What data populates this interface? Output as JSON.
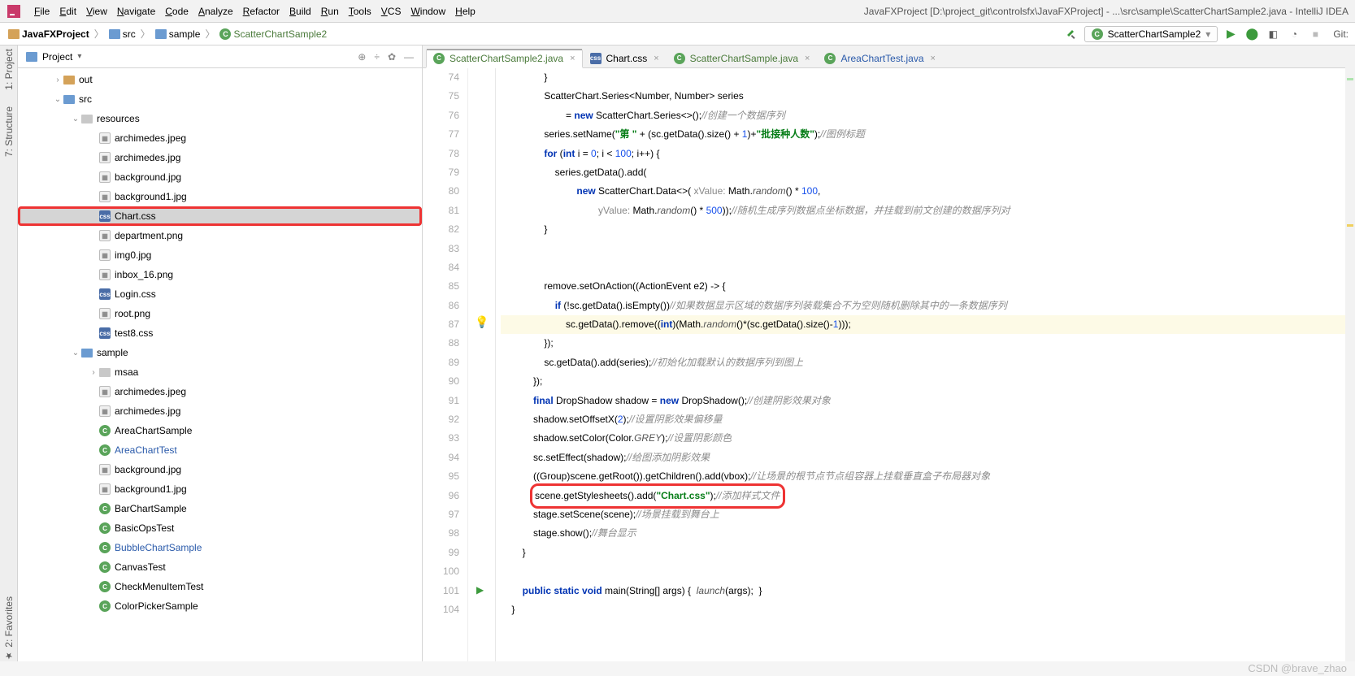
{
  "window": {
    "title": "JavaFXProject [D:\\project_git\\controlsfx\\JavaFXProject] - ...\\src\\sample\\ScatterChartSample2.java - IntelliJ IDEA"
  },
  "menu": [
    "File",
    "Edit",
    "View",
    "Navigate",
    "Code",
    "Analyze",
    "Refactor",
    "Build",
    "Run",
    "Tools",
    "VCS",
    "Window",
    "Help"
  ],
  "breadcrumb": {
    "items": [
      {
        "icon": "folder-orange",
        "text": "JavaFXProject",
        "bold": true
      },
      {
        "icon": "folder-blue",
        "text": "src"
      },
      {
        "icon": "folder-blue",
        "text": "sample"
      },
      {
        "icon": "class",
        "text": "ScatterChartSample2",
        "green": true
      }
    ]
  },
  "runConfig": "ScatterChartSample2",
  "gitLabel": "Git:",
  "projectPanel": {
    "title": "Project"
  },
  "tree": [
    {
      "indent": 1,
      "toggle": ">",
      "icon": "folder-orange",
      "label": "out"
    },
    {
      "indent": 1,
      "toggle": "v",
      "icon": "folder-blue",
      "label": "src"
    },
    {
      "indent": 2,
      "toggle": "v",
      "icon": "folder-gray",
      "label": "resources"
    },
    {
      "indent": 3,
      "icon": "img",
      "label": "archimedes.jpeg"
    },
    {
      "indent": 3,
      "icon": "img",
      "label": "archimedes.jpg"
    },
    {
      "indent": 3,
      "icon": "img",
      "label": "background.jpg"
    },
    {
      "indent": 3,
      "icon": "img",
      "label": "background1.jpg"
    },
    {
      "indent": 3,
      "icon": "css",
      "label": "Chart.css",
      "selected": true,
      "highlighted": true
    },
    {
      "indent": 3,
      "icon": "img",
      "label": "department.png"
    },
    {
      "indent": 3,
      "icon": "img",
      "label": "img0.jpg"
    },
    {
      "indent": 3,
      "icon": "img",
      "label": "inbox_16.png"
    },
    {
      "indent": 3,
      "icon": "css",
      "label": "Login.css"
    },
    {
      "indent": 3,
      "icon": "img",
      "label": "root.png"
    },
    {
      "indent": 3,
      "icon": "css",
      "label": "test8.css"
    },
    {
      "indent": 2,
      "toggle": "v",
      "icon": "folder-blue",
      "label": "sample"
    },
    {
      "indent": 3,
      "toggle": ">",
      "icon": "folder-gray",
      "label": "msaa"
    },
    {
      "indent": 3,
      "icon": "img",
      "label": "archimedes.jpeg"
    },
    {
      "indent": 3,
      "icon": "img",
      "label": "archimedes.jpg"
    },
    {
      "indent": 3,
      "icon": "cls",
      "label": "AreaChartSample"
    },
    {
      "indent": 3,
      "icon": "cls",
      "label": "AreaChartTest",
      "blue": true
    },
    {
      "indent": 3,
      "icon": "img",
      "label": "background.jpg"
    },
    {
      "indent": 3,
      "icon": "img",
      "label": "background1.jpg"
    },
    {
      "indent": 3,
      "icon": "cls",
      "label": "BarChartSample"
    },
    {
      "indent": 3,
      "icon": "cls",
      "label": "BasicOpsTest"
    },
    {
      "indent": 3,
      "icon": "cls",
      "label": "BubbleChartSample",
      "blue": true
    },
    {
      "indent": 3,
      "icon": "cls",
      "label": "CanvasTest"
    },
    {
      "indent": 3,
      "icon": "cls",
      "label": "CheckMenuItemTest"
    },
    {
      "indent": 3,
      "icon": "cls",
      "label": "ColorPickerSample"
    }
  ],
  "tabs": [
    {
      "icon": "cls",
      "label": "ScatterChartSample2.java",
      "active": true,
      "green": true
    },
    {
      "icon": "css",
      "label": "Chart.css"
    },
    {
      "icon": "cls",
      "label": "ScatterChartSample.java",
      "green": true
    },
    {
      "icon": "cls",
      "label": "AreaChartTest.java",
      "blue": true
    }
  ],
  "code": {
    "startLine": 74,
    "lines": [
      {
        "n": 74,
        "html": "                }"
      },
      {
        "n": 75,
        "html": "                ScatterChart.Series&lt;Number, Number&gt; series"
      },
      {
        "n": 76,
        "html": "                        = <span class='kw'>new</span> ScatterChart.Series&lt;&gt;();<span class='cmt'>//创建一个数据序列</span>"
      },
      {
        "n": 77,
        "html": "                series.setName(<span class='str'>\"第 \"</span> + (sc.getData().size() + <span class='num'>1</span>)+<span class='str'>\"批接种人数\"</span>);<span class='cmt'>//图例标题</span>"
      },
      {
        "n": 78,
        "html": "                <span class='kw'>for</span> (<span class='kw'>int</span> i = <span class='num'>0</span>; i &lt; <span class='num'>100</span>; i++) {"
      },
      {
        "n": 79,
        "html": "                    series.getData().add("
      },
      {
        "n": 80,
        "html": "                            <span class='kw'>new</span> ScatterChart.Data&lt;&gt;( <span class='param'>xValue:</span> Math.<span class='it'>random</span>() * <span class='num'>100</span>,"
      },
      {
        "n": 81,
        "html": "                                    <span class='param'>yValue:</span> Math.<span class='it'>random</span>() * <span class='num'>500</span>));<span class='cmt'>//随机生成序列数据点坐标数据，并挂载到前文创建的数据序列对</span>"
      },
      {
        "n": 82,
        "html": "                }"
      },
      {
        "n": 83,
        "html": ""
      },
      {
        "n": 84,
        "html": ""
      },
      {
        "n": 85,
        "html": "                remove.setOnAction((ActionEvent e2) -&gt; {"
      },
      {
        "n": 86,
        "html": "                    <span class='kw'>if</span> (!sc.getData().isEmpty())<span class='cmt'>//如果数据显示区域的数据序列装载集合不为空则随机删除其中的一条数据序列</span>"
      },
      {
        "n": 87,
        "curr": true,
        "html": "                        sc.getData().remove((<span class='kw'>int</span>)(Math.<span class='it'>random</span>()*(sc.getData().size()-<span class='num'>1</span>)));"
      },
      {
        "n": 88,
        "html": "                });"
      },
      {
        "n": 89,
        "html": "                sc.getData().add(series);<span class='cmt'>//初始化加载默认的数据序列到图上</span>"
      },
      {
        "n": 90,
        "html": "            });"
      },
      {
        "n": 91,
        "html": "            <span class='kw'>final</span> DropShadow shadow = <span class='kw'>new</span> DropShadow();<span class='cmt'>//创建阴影效果对象</span>"
      },
      {
        "n": 92,
        "html": "            shadow.setOffsetX(<span class='num'>2</span>);<span class='cmt'>//设置阴影效果偏移量</span>"
      },
      {
        "n": 93,
        "html": "            shadow.setColor(Color.<span class='it'>GREY</span>);<span class='cmt'>//设置阴影颜色</span>"
      },
      {
        "n": 94,
        "html": "            sc.setEffect(shadow);<span class='cmt'>//给图添加阴影效果</span>"
      },
      {
        "n": 95,
        "html": "            ((Group)scene.getRoot()).getChildren().add(vbox);<span class='cmt'>//让场景的根节点节点组容器上挂载垂直盒子布局器对象</span>"
      },
      {
        "n": 96,
        "html": "            <span class='hl-box'>scene.getStylesheets().add(<span class='str'>\"Chart.css\"</span>);<span class='cmt'>//添加样式文件</span></span>"
      },
      {
        "n": 97,
        "html": "            stage.setScene(scene);<span class='cmt'>//场景挂载到舞台上</span>"
      },
      {
        "n": 98,
        "html": "            stage.show();<span class='cmt'>//舞台显示</span>"
      },
      {
        "n": 99,
        "html": "        }"
      },
      {
        "n": 100,
        "html": ""
      },
      {
        "n": 101,
        "html": "        <span class='kw'>public static void</span> main(String[] args) {  <span class='it'>launch</span>(args);  }"
      },
      {
        "n": 104,
        "html": "    }"
      }
    ]
  },
  "edgeLabels": [
    "1: Project",
    "7: Structure",
    "2: Favorites"
  ],
  "watermark": "CSDN @brave_zhao"
}
